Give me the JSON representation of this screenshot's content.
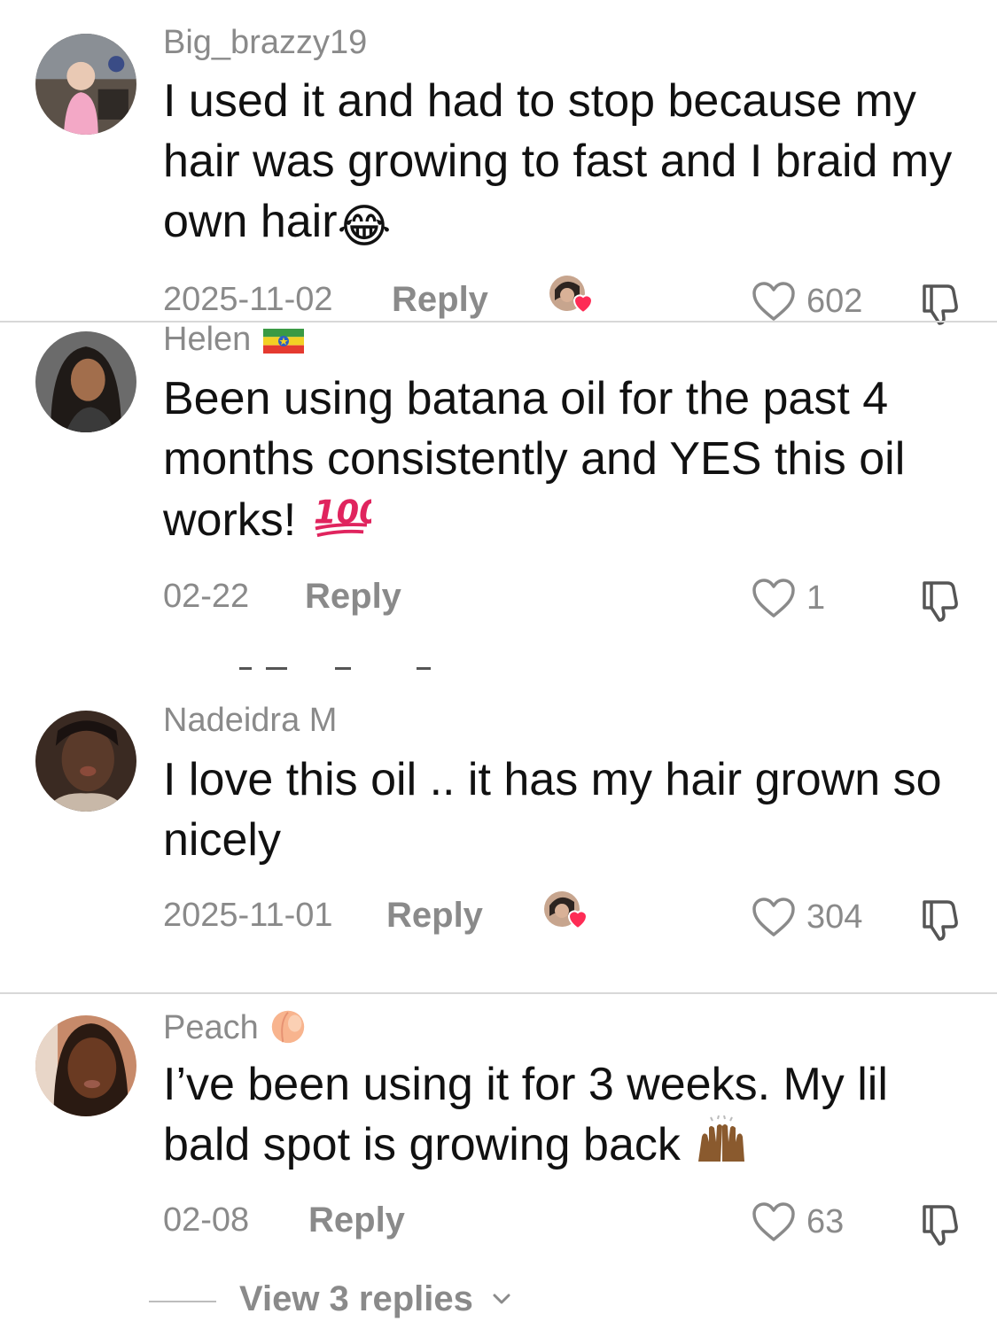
{
  "comments": [
    {
      "username": "Big_brazzy19",
      "text": "I used it and had to stop because my hair was growing to fast and I braid my own hair",
      "emoji": "😂",
      "date": "2025-11-02",
      "reply_label": "Reply",
      "likes": "602",
      "liked_by_creator": true
    },
    {
      "username": "Helen",
      "username_emoji": "flag-icon",
      "text": "Been using batana oil for the past 4 months consistently and YES this oil works!",
      "emoji": "💯",
      "date": "02-22",
      "reply_label": "Reply",
      "likes": "1",
      "liked_by_creator": false
    },
    {
      "username": "Nadeidra M",
      "text": "I love this oil .. it has my hair grown so nicely",
      "date": "2025-11-01",
      "reply_label": "Reply",
      "likes": "304",
      "liked_by_creator": true
    },
    {
      "username": "Peach",
      "username_emoji": "🍑",
      "text": "I’ve been using it for 3 weeks. My lil bald spot is growing back",
      "emoji": "🙌🏾",
      "date": "02-08",
      "reply_label": "Reply",
      "likes": "63",
      "liked_by_creator": false
    }
  ],
  "view_replies": {
    "label": "View 3 replies"
  },
  "colors": {
    "meta_gray": "#8a8a8a",
    "heart_red": "#fe2c55",
    "divider": "#d8d8d8"
  }
}
